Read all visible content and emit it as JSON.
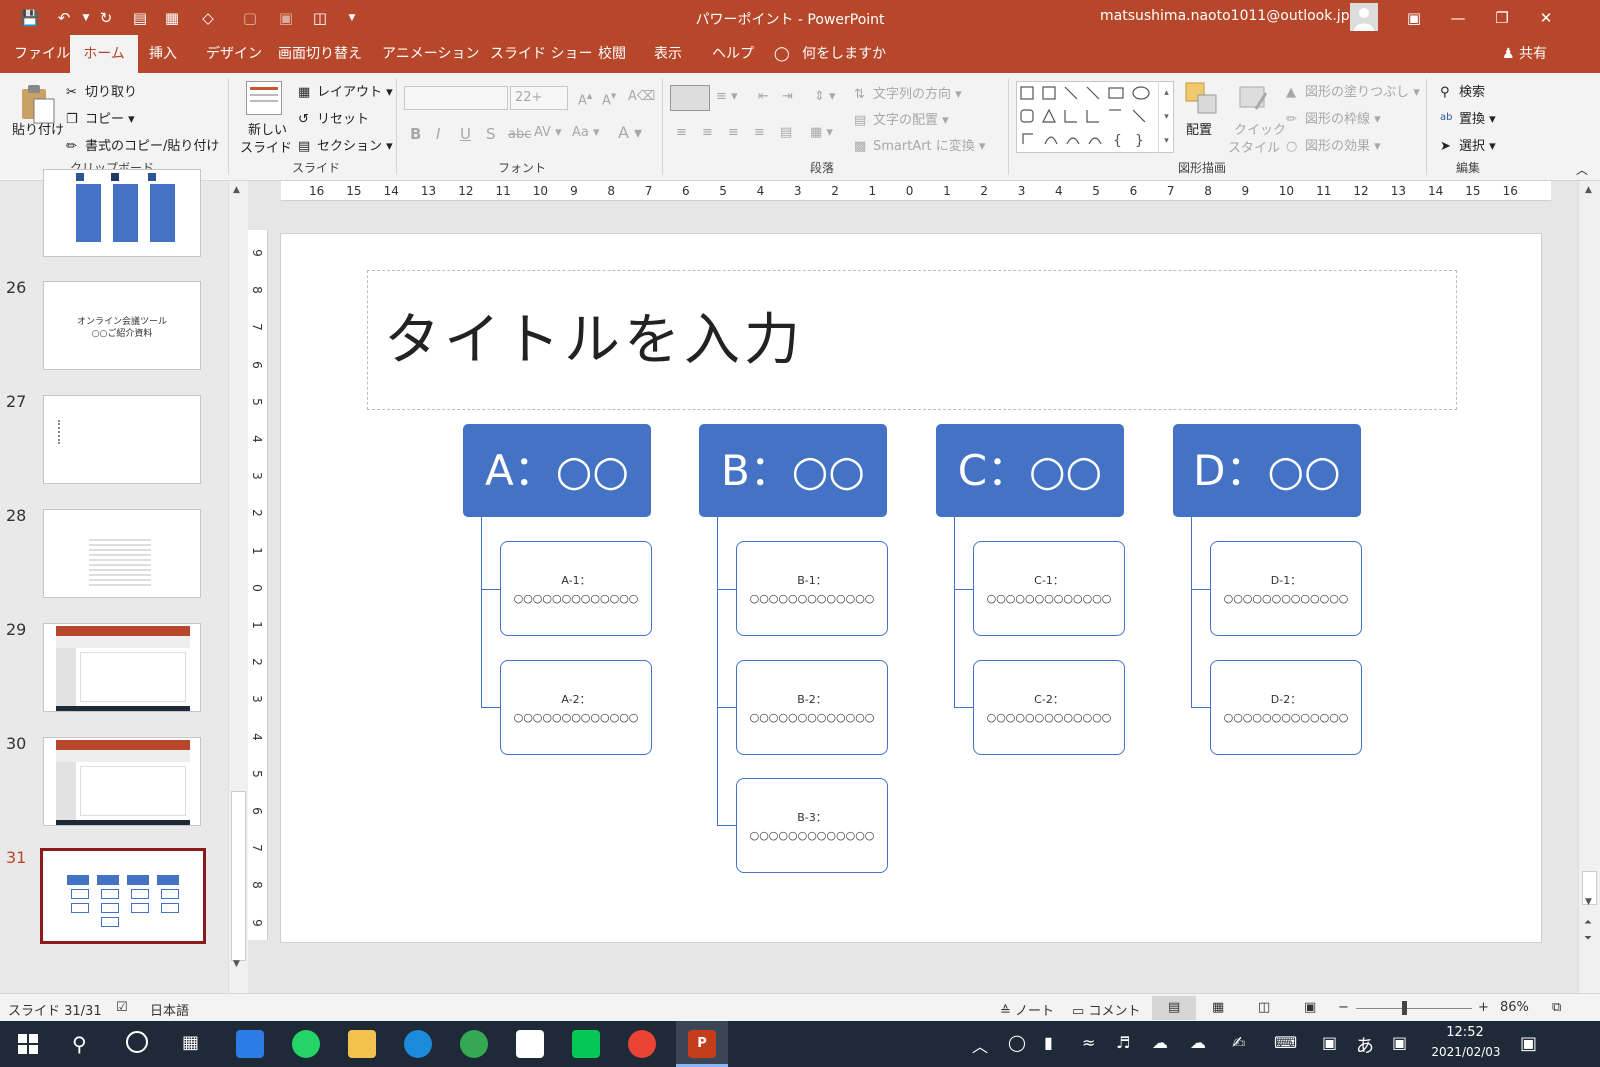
{
  "titlebar": {
    "title": "パワーポイント  -  PowerPoint",
    "user": "matsushima.naoto1011@outlook.jp"
  },
  "tabs": {
    "file": "ファイル",
    "home": "ホーム",
    "insert": "挿入",
    "design": "デザイン",
    "transitions": "画面切り替え",
    "animations": "アニメーション",
    "slideshow": "スライド ショー",
    "review": "校閲",
    "view": "表示",
    "help": "ヘルプ",
    "tellme": "何をしますか",
    "share": "共有"
  },
  "ribbon": {
    "clipboard": {
      "paste": "貼り付け",
      "cut": "切り取り",
      "copy": "コピー",
      "format_painter": "書式のコピー/貼り付け",
      "group": "クリップボード"
    },
    "slides": {
      "new_slide_1": "新しい",
      "new_slide_2": "スライド",
      "layout": "レイアウト",
      "reset": "リセット",
      "section": "セクション",
      "group": "スライド"
    },
    "font": {
      "size": "22+",
      "group": "フォント"
    },
    "paragraph": {
      "text_direction": "文字列の方向",
      "align_text": "文字の配置",
      "smartart": "SmartArt に変換",
      "group": "段落"
    },
    "drawing": {
      "arrange": "配置",
      "quick_styles_1": "クイック",
      "quick_styles_2": "スタイル",
      "shape_fill": "図形の塗りつぶし",
      "shape_outline": "図形の枠線",
      "shape_effects": "図形の効果",
      "group": "図形描画"
    },
    "editing": {
      "find": "検索",
      "replace": "置換",
      "select": "選択",
      "group": "編集"
    }
  },
  "thumbnails": [
    {
      "num": "",
      "line1": "",
      "line2": ""
    },
    {
      "num": "26",
      "line1": "オンライン会議ツール",
      "line2": "○○ご紹介資料"
    },
    {
      "num": "27",
      "line1": "",
      "line2": ""
    },
    {
      "num": "28",
      "line1": "",
      "line2": ""
    },
    {
      "num": "29",
      "line1": "",
      "line2": ""
    },
    {
      "num": "30",
      "line1": "",
      "line2": ""
    },
    {
      "num": "31",
      "line1": "",
      "line2": ""
    }
  ],
  "slide": {
    "title": "タイトルを入力",
    "groups": [
      {
        "header": "A：○○",
        "items": [
          "A-1：",
          "A-2："
        ]
      },
      {
        "header": "B：○○",
        "items": [
          "B-1：",
          "B-2：",
          "B-3："
        ]
      },
      {
        "header": "C：○○",
        "items": [
          "C-1：",
          "C-2："
        ]
      },
      {
        "header": "D：○○",
        "items": [
          "D-1：",
          "D-2："
        ]
      }
    ],
    "item_body": "○○○○○○○○○○○○○"
  },
  "ruler": {
    "h_ticks": [
      "16",
      "15",
      "14",
      "13",
      "12",
      "11",
      "10",
      "9",
      "8",
      "7",
      "6",
      "5",
      "4",
      "3",
      "2",
      "1",
      "0",
      "1",
      "2",
      "3",
      "4",
      "5",
      "6",
      "7",
      "8",
      "9",
      "10",
      "11",
      "12",
      "13",
      "14",
      "15",
      "16"
    ],
    "v_ticks": [
      "9",
      "8",
      "7",
      "6",
      "5",
      "4",
      "3",
      "2",
      "1",
      "0",
      "1",
      "2",
      "3",
      "4",
      "5",
      "6",
      "7",
      "8",
      "9"
    ]
  },
  "status": {
    "slide_info": "スライド 31/31",
    "language": "日本語",
    "notes": "ノート",
    "comments": "コメント",
    "zoom": "86%"
  },
  "taskbar": {
    "time": "12:52",
    "date": "2021/02/03",
    "ime": "あ"
  },
  "colors": {
    "accent": "#b7472a",
    "shape_blue": "#4472c4"
  }
}
